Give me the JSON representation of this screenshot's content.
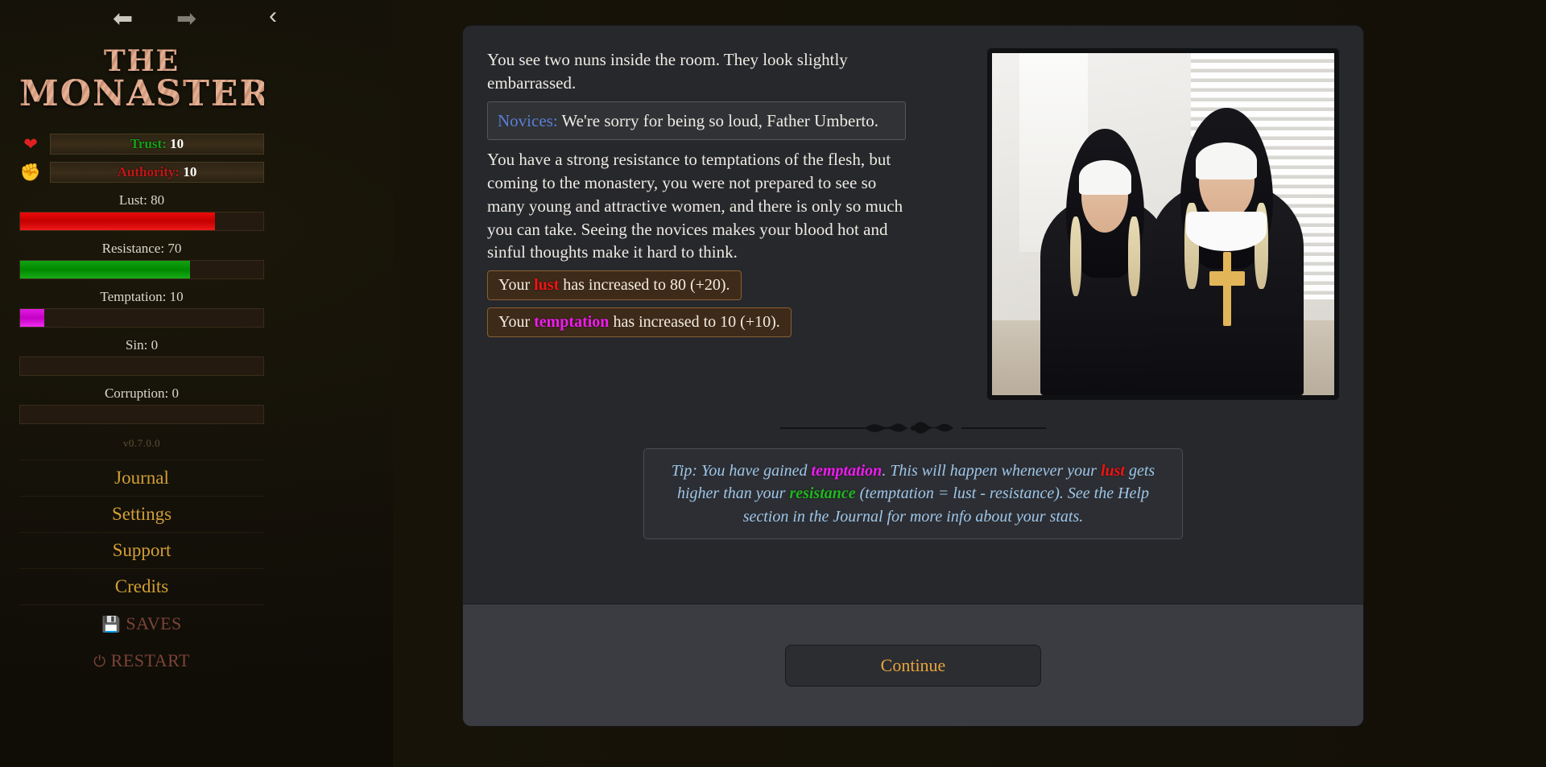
{
  "nav": {
    "back_icon": "arrow-left",
    "forward_icon": "arrow-right",
    "collapse_icon": "chevron-left",
    "back_glyph": "⬅",
    "forward_glyph": "➡",
    "collapse_glyph": "‹"
  },
  "sidebar": {
    "title_line1": "THE",
    "title_line2": "MONASTERY",
    "version": "v0.7.0.0",
    "stats": [
      {
        "icon": "heart-icon",
        "glyph": "❤",
        "key": "Trust:",
        "value": "10",
        "key_color": "#16a016"
      },
      {
        "icon": "fist-icon",
        "glyph": "✊",
        "key": "Authority:",
        "value": "10",
        "key_color": "#c01717"
      }
    ],
    "bars": [
      {
        "name": "lust",
        "label": "Lust: 80",
        "value": 80,
        "max": 100,
        "color": "#ec0b0b"
      },
      {
        "name": "resistance",
        "label": "Resistance: 70",
        "value": 70,
        "max": 100,
        "color": "#12a312"
      },
      {
        "name": "temptation",
        "label": "Temptation: 10",
        "value": 10,
        "max": 100,
        "color": "#e01ce0"
      },
      {
        "name": "sin",
        "label": "Sin: 0",
        "value": 0,
        "max": 100,
        "color": "#8a2020"
      },
      {
        "name": "corruption",
        "label": "Corruption: 0",
        "value": 0,
        "max": 100,
        "color": "#7b2fb0"
      }
    ],
    "menu": [
      {
        "label": "Journal"
      },
      {
        "label": "Settings"
      },
      {
        "label": "Support"
      },
      {
        "label": "Credits"
      }
    ],
    "system": [
      {
        "icon": "floppy-disk-icon",
        "glyph": "💾",
        "label": "SAVES"
      },
      {
        "icon": "power-icon",
        "glyph": "⏻",
        "label": "RESTART"
      }
    ]
  },
  "main": {
    "narration_1": "You see two nuns inside the room. They look slightly embarrassed.",
    "dialogue": {
      "speaker": "Novices:",
      "text": "We're sorry for being so loud, Father Umberto."
    },
    "narration_2": "You have a strong resistance to temptations of the flesh, but coming to the monastery, you were not prepared to see so many young and attractive women, and there is only so much you can take. Seeing the novices makes your blood hot and sinful thoughts make it hard to think.",
    "stat_messages": [
      {
        "prefix": "Your ",
        "keyword": "lust",
        "keyword_class": "kw-lust",
        "suffix": " has increased to 80 (+20)."
      },
      {
        "prefix": "Your ",
        "keyword": "temptation",
        "keyword_class": "kw-temptation",
        "suffix": " has increased to 10 (+10)."
      }
    ],
    "image": {
      "name": "scene-image-two-nuns",
      "alt": "Two nuns standing in a bright room with window blinds"
    },
    "tip": {
      "p1": "Tip: You have gained ",
      "kw1": "temptation",
      "p2": ". This will happen whenever your ",
      "kw2": "lust",
      "p3": " gets higher than your ",
      "kw3": "resistance",
      "p4": " (temptation = lust - resistance).",
      "p5": "See the Help section in the Journal for more info about your stats."
    },
    "continue_label": "Continue"
  }
}
